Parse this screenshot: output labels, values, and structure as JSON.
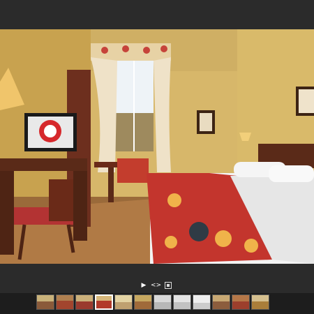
{
  "gallery": {
    "main_image_icon": "photo-icon",
    "controls": {
      "play": "▶",
      "nav": "<>"
    },
    "icons": {
      "play": "play-icon",
      "nav": "prev-next-icon",
      "stop": "stop-icon"
    },
    "thumbnail_count": 12,
    "active_thumbnail": 4
  },
  "colors": {
    "chrome_background": "#2b2b2b",
    "thumbnail_strip_background": "#1d1d1d",
    "active_thumbnail_border": "#ffffff"
  }
}
